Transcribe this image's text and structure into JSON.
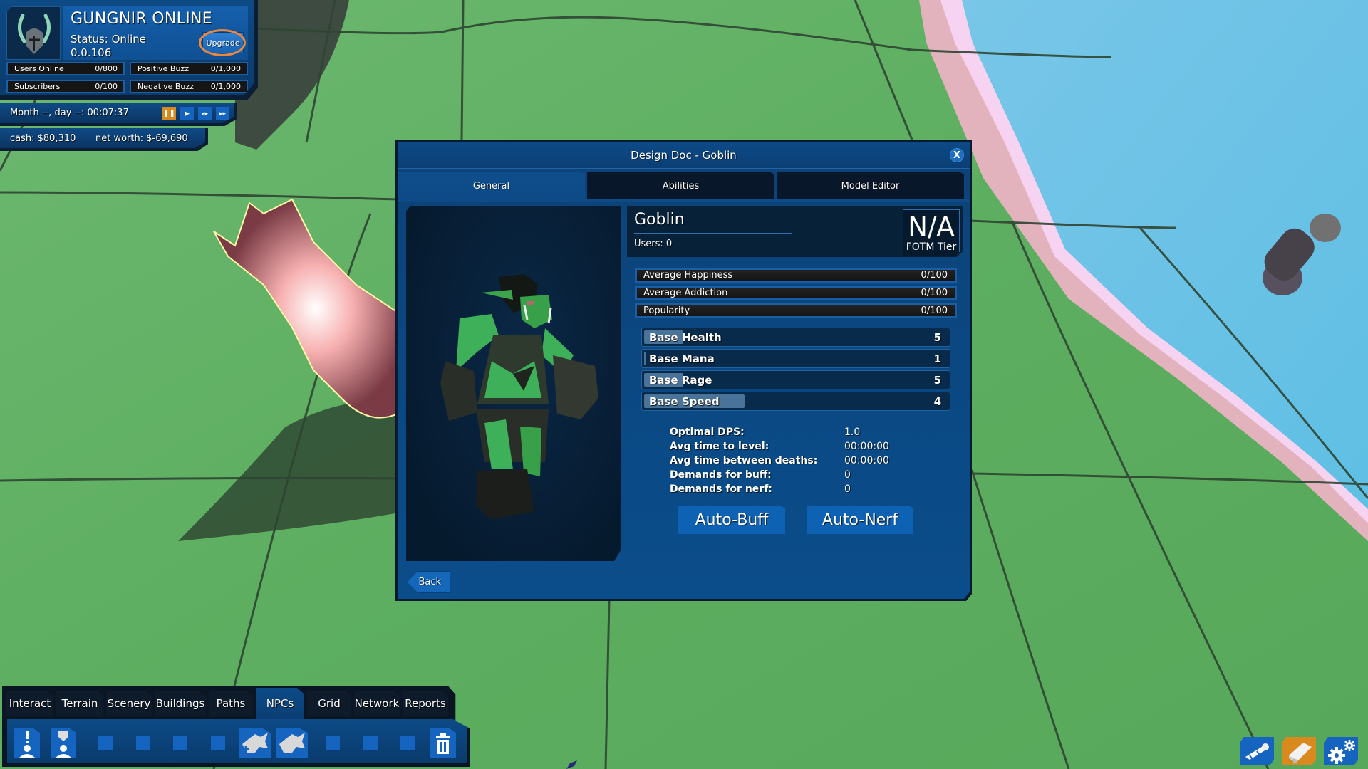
{
  "hud": {
    "game_title": "GUNGNIR ONLINE",
    "status": "Status: Online",
    "version": "0.0.106",
    "upgrade_label": "Upgrade",
    "stats": [
      {
        "label": "Users Online",
        "value": "0/800"
      },
      {
        "label": "Positive Buzz",
        "value": "0/1,000"
      },
      {
        "label": "Subscribers",
        "value": "0/100"
      },
      {
        "label": "Negative Buzz",
        "value": "0/1,000"
      }
    ],
    "time": "Month --, day --: 00:07:37",
    "time_controls": [
      {
        "name": "pause",
        "glyph": "❚❚",
        "active": true
      },
      {
        "name": "play",
        "glyph": "▶",
        "active": false
      },
      {
        "name": "fast",
        "glyph": "▸▸",
        "active": false
      },
      {
        "name": "fastest",
        "glyph": "▸▸",
        "active": false
      }
    ],
    "cash": "cash: $80,310",
    "net_worth": "net worth: $-69,690"
  },
  "dialog": {
    "title": "Design Doc - Goblin",
    "close_label": "X",
    "tabs": [
      {
        "label": "General",
        "active": true
      },
      {
        "label": "Abilities",
        "active": false
      },
      {
        "label": "Model Editor",
        "active": false
      }
    ],
    "npc_name": "Goblin",
    "users": "Users: 0",
    "fotm_value": "N/A",
    "fotm_label": "FOTM Tier",
    "meters": [
      {
        "label": "Average Happiness",
        "value": "0/100"
      },
      {
        "label": "Average Addiction",
        "value": "0/100"
      },
      {
        "label": "Popularity",
        "value": "0/100"
      }
    ],
    "base_stats": [
      {
        "label": "Base Health",
        "value": "5",
        "fill_fraction": 0.13
      },
      {
        "label": "Base Mana",
        "value": "1",
        "fill_fraction": 0.0
      },
      {
        "label": "Base Rage",
        "value": "5",
        "fill_fraction": 0.13
      },
      {
        "label": "Base Speed",
        "value": "4",
        "fill_fraction": 0.33
      }
    ],
    "performance": [
      {
        "label": "Optimal DPS:",
        "value": "1.0"
      },
      {
        "label": "Avg time to level:",
        "value": "00:00:00"
      },
      {
        "label": "Avg time between deaths:",
        "value": "00:00:00"
      },
      {
        "label": "Demands for buff:",
        "value": "0"
      },
      {
        "label": "Demands for nerf:",
        "value": "0"
      }
    ],
    "auto_buff_label": "Auto-Buff",
    "auto_nerf_label": "Auto-Nerf",
    "back_label": "Back"
  },
  "toolbar": {
    "tabs": [
      {
        "label": "Interact",
        "active": false
      },
      {
        "label": "Terrain",
        "active": false
      },
      {
        "label": "Scenery",
        "active": false
      },
      {
        "label": "Buildings",
        "active": false
      },
      {
        "label": "Paths",
        "active": false
      },
      {
        "label": "NPCs",
        "active": true
      },
      {
        "label": "Grid",
        "active": false
      },
      {
        "label": "Network",
        "active": false
      },
      {
        "label": "Reports",
        "active": false
      }
    ],
    "tools": [
      {
        "name": "quest-giver-npc",
        "icon": "quest-npc-icon"
      },
      {
        "name": "guard-npc",
        "icon": "guard-npc-icon"
      },
      {
        "name": "empty-slot-1",
        "icon": "empty-slot"
      },
      {
        "name": "empty-slot-2",
        "icon": "empty-slot"
      },
      {
        "name": "empty-slot-3",
        "icon": "empty-slot"
      },
      {
        "name": "empty-slot-4",
        "icon": "empty-slot"
      },
      {
        "name": "add-monster",
        "icon": "add-monster-icon"
      },
      {
        "name": "monster",
        "icon": "monster-icon"
      },
      {
        "name": "empty-slot-5",
        "icon": "empty-slot"
      },
      {
        "name": "empty-slot-6",
        "icon": "empty-slot"
      },
      {
        "name": "empty-slot-7",
        "icon": "empty-slot"
      },
      {
        "name": "delete",
        "icon": "trash-icon"
      }
    ]
  },
  "corner_buttons": [
    {
      "name": "diploma",
      "icon": "scroll-icon",
      "color": "#1565c0"
    },
    {
      "name": "design-doc",
      "icon": "book-icon",
      "color": "#d98a1f"
    },
    {
      "name": "settings",
      "icon": "gear-icon",
      "color": "#1565c0"
    }
  ],
  "colors": {
    "panel_blue": "#0d4a86",
    "button_blue": "#1565c0",
    "accent_orange": "#f0883a",
    "pause_orange": "#d98a1f",
    "grass": "#63b466",
    "sand": "#e6b6c0",
    "water": "#6cc3e6"
  }
}
